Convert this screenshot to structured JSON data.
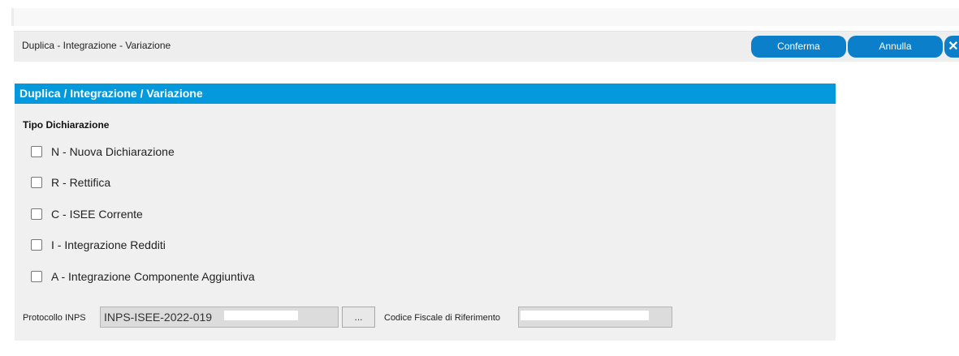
{
  "toolbar": {
    "title": "Duplica - Integrazione - Variazione",
    "confirm_label": "Conferma",
    "cancel_label": "Annulla",
    "close_glyph": "✕"
  },
  "panel": {
    "header": "Duplica / Integrazione / Variazione",
    "section_label": "Tipo Dichiarazione",
    "options": [
      {
        "code": "N",
        "text": " - Nuova Dichiarazione",
        "checked": false
      },
      {
        "code": "R",
        "text": " - Rettifica",
        "checked": false
      },
      {
        "code": "C",
        "text": " - ISEE Corrente",
        "checked": false
      },
      {
        "code": "I",
        "text": " - Integrazione Redditi",
        "checked": false
      },
      {
        "code": "A",
        "text": " - Integrazione Componente Aggiuntiva",
        "checked": false
      }
    ],
    "protocol_label": "Protocollo INPS",
    "protocol_value": "INPS-ISEE-2022-019",
    "browse_label": "...",
    "fiscal_code_label": "Codice Fiscale di Riferimento",
    "fiscal_code_value": ""
  },
  "colors": {
    "accent": "#0b7fca",
    "header": "#0399dc",
    "panel_bg": "#f0f0f0"
  }
}
